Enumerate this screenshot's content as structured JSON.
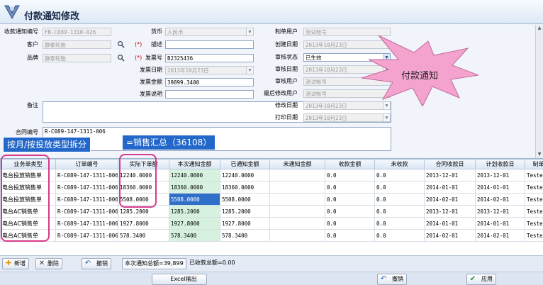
{
  "window": {
    "title": "付款通知修改"
  },
  "form": {
    "labels": {
      "receipt_no": "收款通知编号",
      "customer": "客户",
      "brand": "品牌",
      "currency": "货币",
      "description": "描述",
      "invoice_no": "发票号",
      "invoice_date": "发票日期",
      "invoice_amount": "发票金额",
      "invoice_note": "发票说明",
      "remark": "备注",
      "contract_no": "合同编号",
      "creator": "制单用户",
      "created_date": "创建日期",
      "audit_status": "审核状态",
      "audit_date": "审核日期",
      "auditor": "审核用户",
      "last_modifier": "最后修改用户",
      "modified_date": "修改日期",
      "print_date": "打印日期"
    },
    "values": {
      "receipt_no": "FN-C089-1310-026",
      "customer": "静泰轮胎",
      "brand": "静泰轮胎",
      "currency": "人民币",
      "description": "",
      "invoice_no": "B2325436",
      "invoice_date": "2013年10月23日",
      "invoice_amount": "39899.3400",
      "invoice_note": "",
      "remark": "",
      "contract_no": "R-C089-147-1311-006",
      "creator": "测试帐号",
      "created_date": "2013年10月23日",
      "audit_status": "已生效",
      "audit_date": "2013年10月23日",
      "auditor": "测试帐号",
      "last_modifier": "测试帐号",
      "modified_date": "2013年10月23日",
      "print_date": "2013年10月23日"
    },
    "required_mark": "(*)"
  },
  "grid": {
    "columns": [
      "业务单类型",
      "订单编号",
      "实际下单额",
      "本次通知金额",
      "已通知金额",
      "未通知金额",
      "收款金额",
      "未收款",
      "合同收款日",
      "计划收款日",
      "制单"
    ],
    "rows": [
      [
        "电台投放销售单",
        "R-C089-147-1311-006",
        "12240.0000",
        "12240.0000",
        "12240.0000",
        "",
        "0.0",
        "0.0",
        "2013-12-01",
        "2013-12-01",
        "Tester"
      ],
      [
        "电台投放销售单",
        "R-C089-147-1311-006",
        "18360.0000",
        "18360.0000",
        "18360.0000",
        "",
        "0.0",
        "0.0",
        "2014-01-01",
        "2014-01-01",
        "Tester"
      ],
      [
        "电台投放销售单",
        "R-C089-147-1311-006",
        "5508.0000",
        "5508.0000",
        "5508.0000",
        "",
        "0.0",
        "0.0",
        "2014-02-01",
        "2014-02-01",
        "Tester"
      ],
      [
        "电台AC销售单",
        "R-C089-147-1311-006",
        "1285.2000",
        "1285.2000",
        "1285.2000",
        "",
        "0.0",
        "0.0",
        "2013-12-01",
        "2013-12-01",
        "Tester"
      ],
      [
        "电台AC销售单",
        "R-C089-147-1311-006",
        "1927.8000",
        "1927.8000",
        "1927.8000",
        "",
        "0.0",
        "0.0",
        "2014-01-01",
        "2014-01-01",
        "Tester"
      ],
      [
        "电台AC销售单",
        "R-C089-147-1311-006",
        "578.3400",
        "578.3400",
        "578.3400",
        "",
        "0.0",
        "0.0",
        "2014-02-01",
        "2014-02-01",
        "Tester"
      ]
    ]
  },
  "toolbar": {
    "add": "新增",
    "delete": "删除",
    "undo": "撤销",
    "notify_total": "本次通知总额=39,899",
    "received_total": "已收款总额=0.00",
    "excel": "Excel输出",
    "cancel": "撤销",
    "apply": "应用"
  },
  "annotations": {
    "split_note": "按月/按投放类型拆分",
    "sum_note": "=销售汇总（36108）",
    "callout": "付款通知"
  },
  "colors": {
    "highlight_border": "#d63a8c",
    "label_bg": "#2267c9",
    "callout_fill": "#f4a3cf",
    "notify_col": "#d6f2df",
    "selected_cell": "#2f6fc7"
  }
}
